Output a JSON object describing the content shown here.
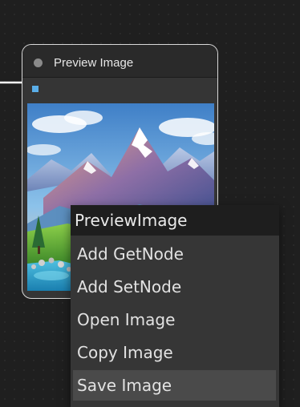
{
  "node": {
    "title": "Preview Image"
  },
  "context_menu": {
    "title": "PreviewImage",
    "items": [
      {
        "label": "Add GetNode"
      },
      {
        "label": "Add SetNode"
      },
      {
        "label": "Open Image"
      },
      {
        "label": "Copy Image"
      },
      {
        "label": "Save Image",
        "highlighted": true
      }
    ]
  },
  "colors": {
    "canvas": "#1f1f1f",
    "node_body": "#353535",
    "node_header": "#2a2a2a",
    "node_border": "#d9d9d9",
    "input_slot": "#5aaee8",
    "menu_bg": "#363636",
    "menu_title_bg": "#1e1e1e",
    "menu_highlight": "#4a4a4a"
  }
}
